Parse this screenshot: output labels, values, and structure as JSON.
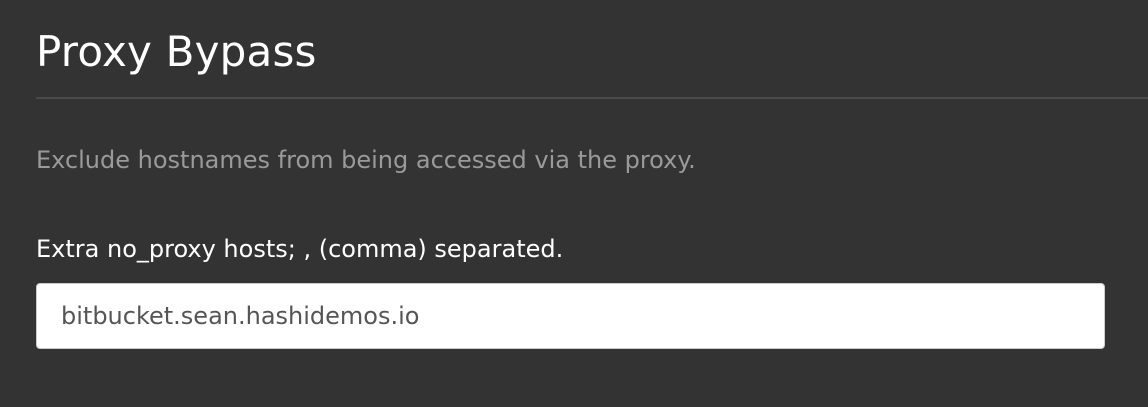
{
  "section": {
    "title": "Proxy Bypass",
    "description": "Exclude hostnames from being accessed via the proxy."
  },
  "no_proxy_field": {
    "label": "Extra no_proxy hosts; , (comma) separated.",
    "value": "bitbucket.sean.hashidemos.io",
    "placeholder": ""
  },
  "colors": {
    "background": "#333333",
    "title": "#ffffff",
    "description": "#9a9a9a",
    "label": "#ffffff",
    "input_background": "#ffffff",
    "input_text": "#555555",
    "divider": "#4a4a4a"
  }
}
